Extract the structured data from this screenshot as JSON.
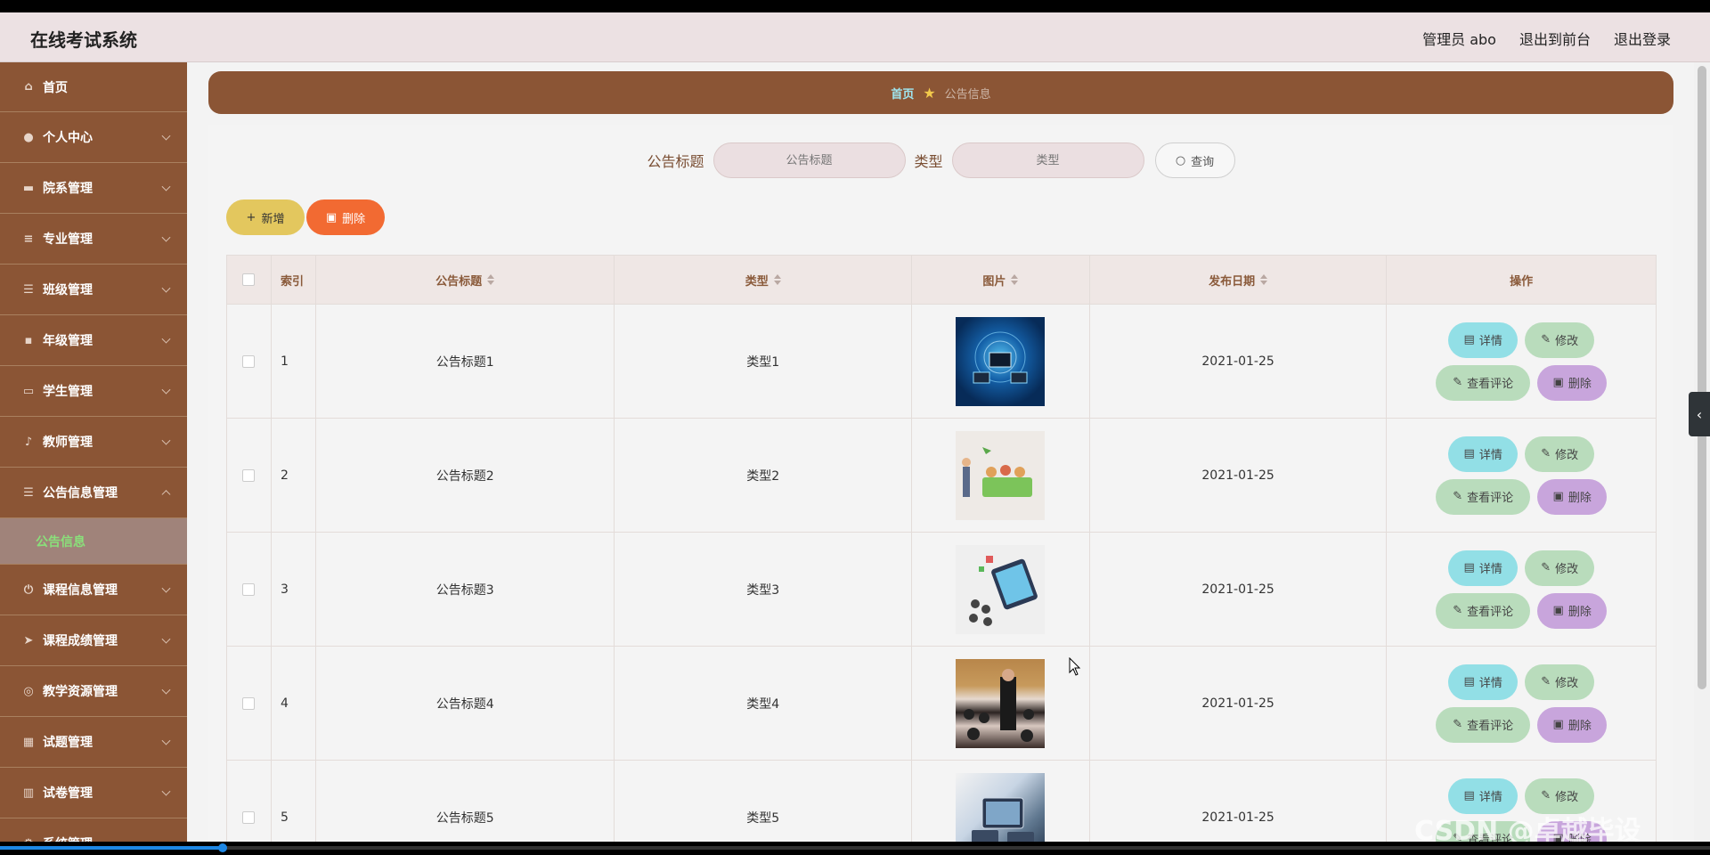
{
  "header": {
    "title": "在线考试系统",
    "user": "管理员 abo",
    "to_frontend": "退出到前台",
    "logout": "退出登录"
  },
  "sidebar": {
    "items": [
      {
        "label": "首页",
        "icon": "home-icon"
      },
      {
        "label": "个人中心",
        "icon": "user-icon"
      },
      {
        "label": "院系管理",
        "icon": "building-icon"
      },
      {
        "label": "专业管理",
        "icon": "sliders-icon"
      },
      {
        "label": "班级管理",
        "icon": "list-icon"
      },
      {
        "label": "年级管理",
        "icon": "chat-icon"
      },
      {
        "label": "学生管理",
        "icon": "monitor-icon"
      },
      {
        "label": "教师管理",
        "icon": "mic-icon"
      },
      {
        "label": "公告信息管理",
        "icon": "list-icon"
      },
      {
        "label": "课程信息管理",
        "icon": "power-icon"
      },
      {
        "label": "课程成绩管理",
        "icon": "send-icon"
      },
      {
        "label": "教学资源管理",
        "icon": "globe-icon"
      },
      {
        "label": "试题管理",
        "icon": "chart-icon"
      },
      {
        "label": "试卷管理",
        "icon": "book-icon"
      },
      {
        "label": "系统管理",
        "icon": "gear-icon"
      }
    ],
    "active_sub": "公告信息"
  },
  "breadcrumb": {
    "home": "首页",
    "current": "公告信息"
  },
  "search": {
    "title_label": "公告标题",
    "title_placeholder": "公告标题",
    "type_label": "类型",
    "type_placeholder": "类型",
    "button": "查询"
  },
  "actions": {
    "add": "新增",
    "delete": "删除"
  },
  "table": {
    "columns": [
      "索引",
      "公告标题",
      "类型",
      "图片",
      "发布日期",
      "操作"
    ],
    "rows": [
      {
        "index": "1",
        "title": "公告标题1",
        "type": "类型1",
        "image": "network-technology-image",
        "date": "2021-01-25"
      },
      {
        "index": "2",
        "title": "公告标题2",
        "type": "类型2",
        "image": "classroom-cartoon-image",
        "date": "2021-01-25"
      },
      {
        "index": "3",
        "title": "公告标题3",
        "type": "类型3",
        "image": "online-learning-image",
        "date": "2021-01-25"
      },
      {
        "index": "4",
        "title": "公告标题4",
        "type": "类型4",
        "image": "lecture-hall-photo",
        "date": "2021-01-25"
      },
      {
        "index": "5",
        "title": "公告标题5",
        "type": "类型5",
        "image": "tablet-devices-image",
        "date": "2021-01-25"
      }
    ],
    "ops": {
      "detail": "详情",
      "edit": "修改",
      "comment": "查看评论",
      "delete": "删除"
    }
  },
  "watermark": "CSDN @卓越毕设",
  "video_progress": 0.13,
  "colors": {
    "sidebar": "#8b5535",
    "topbar": "#ece1e3",
    "add_button": "#e3c75e",
    "delete_button": "#f26a32",
    "detail_button": "#92dfe6",
    "edit_button": "#b9dcbc",
    "delete_row_button": "#c8a5dc",
    "active_sub_text": "#8ae07a"
  }
}
